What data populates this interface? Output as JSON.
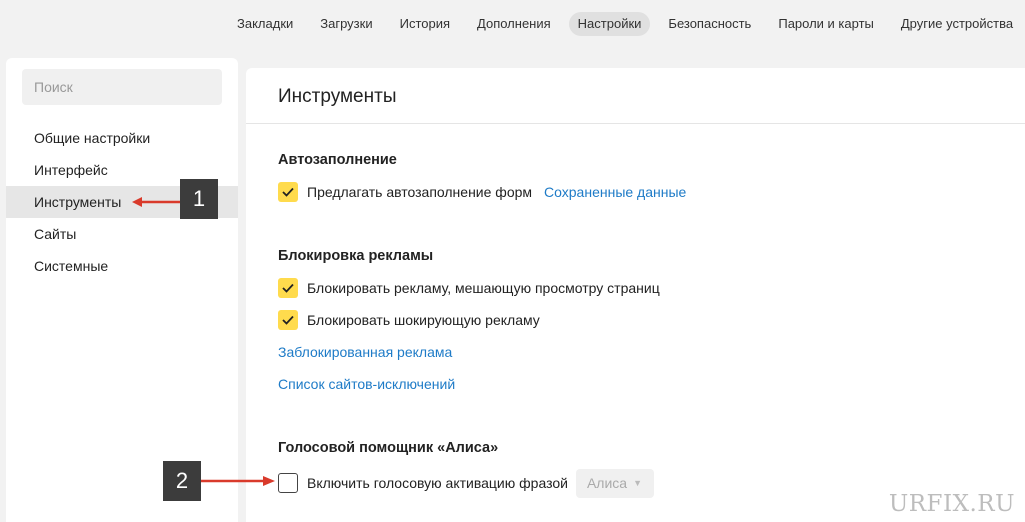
{
  "topnav": {
    "items": [
      {
        "label": "Закладки"
      },
      {
        "label": "Загрузки"
      },
      {
        "label": "История"
      },
      {
        "label": "Дополнения"
      },
      {
        "label": "Настройки",
        "active": true
      },
      {
        "label": "Безопасность"
      },
      {
        "label": "Пароли и карты"
      },
      {
        "label": "Другие устройства"
      }
    ]
  },
  "sidebar": {
    "search_placeholder": "Поиск",
    "items": [
      {
        "label": "Общие настройки"
      },
      {
        "label": "Интерфейс"
      },
      {
        "label": "Инструменты",
        "active": true
      },
      {
        "label": "Сайты"
      },
      {
        "label": "Системные"
      }
    ]
  },
  "main": {
    "title": "Инструменты",
    "autofill": {
      "title": "Автозаполнение",
      "offer_label": "Предлагать автозаполнение форм",
      "offer_checked": true,
      "saved_data_link": "Сохраненные данные"
    },
    "adblock": {
      "title": "Блокировка рекламы",
      "block_interfering_label": "Блокировать рекламу, мешающую просмотру страниц",
      "block_interfering_checked": true,
      "block_shocking_label": "Блокировать шокирующую рекламу",
      "block_shocking_checked": true,
      "blocked_ads_link": "Заблокированная реклама",
      "exceptions_link": "Список сайтов-исключений"
    },
    "alice": {
      "title": "Голосовой помощник «Алиса»",
      "voice_activation_label": "Включить голосовую активацию фразой",
      "voice_activation_checked": false,
      "phrase_select_value": "Алиса"
    }
  },
  "annotations": {
    "badge1": "1",
    "badge2": "2",
    "arrow_color": "#d93a2b"
  },
  "watermark": "URFIX.RU",
  "colors": {
    "accent_checkbox": "#ffdb4d",
    "link": "#1e7bc7"
  }
}
